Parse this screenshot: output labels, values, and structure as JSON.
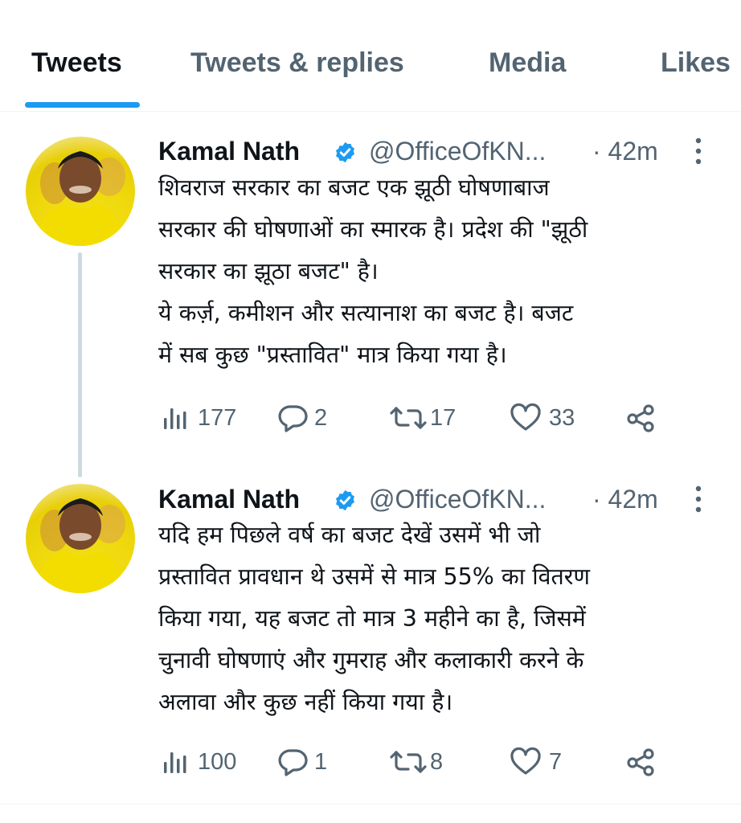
{
  "tabs": [
    {
      "label": "Tweets",
      "active": true
    },
    {
      "label": "Tweets & replies",
      "active": false
    },
    {
      "label": "Media",
      "active": false
    },
    {
      "label": "Likes",
      "active": false
    }
  ],
  "colors": {
    "accent": "#1d9bf0",
    "text_primary": "#0f1419",
    "text_secondary": "#536471",
    "thread_line": "#cfd9de"
  },
  "tweets": [
    {
      "author": "Kamal Nath",
      "verified_icon": "verified-badge-icon",
      "handle": "@OfficeOfKN...",
      "time": "· 42m",
      "text": "शिवराज सरकार का बजट एक झूठी घोषणाबाज\nसरकार की घोषणाओं का स्मारक है। प्रदेश की \"झूठी\nसरकार का झूठा बजट\" है।\nये कर्ज़, कमीशन और सत्यानाश का बजट है। बजट\nमें सब कुछ \"प्रस्तावित\" मात्र किया गया है।",
      "views": "177",
      "replies": "2",
      "retweets": "17",
      "likes": "33"
    },
    {
      "author": "Kamal Nath",
      "verified_icon": "verified-badge-icon",
      "handle": "@OfficeOfKN...",
      "time": "· 42m",
      "text": "यदि हम पिछले वर्ष का बजट देखें उसमें भी जो\nप्रस्तावित प्रावधान थे उसमें से मात्र 55% का वितरण\nकिया गया, यह बजट तो मात्र 3 महीने का है, जिसमें\nचुनावी घोषणाएं और गुमराह और कलाकारी करने के\nअलावा और कुछ नहीं किया गया है।",
      "views": "100",
      "replies": "1",
      "retweets": "8",
      "likes": "7"
    }
  ]
}
